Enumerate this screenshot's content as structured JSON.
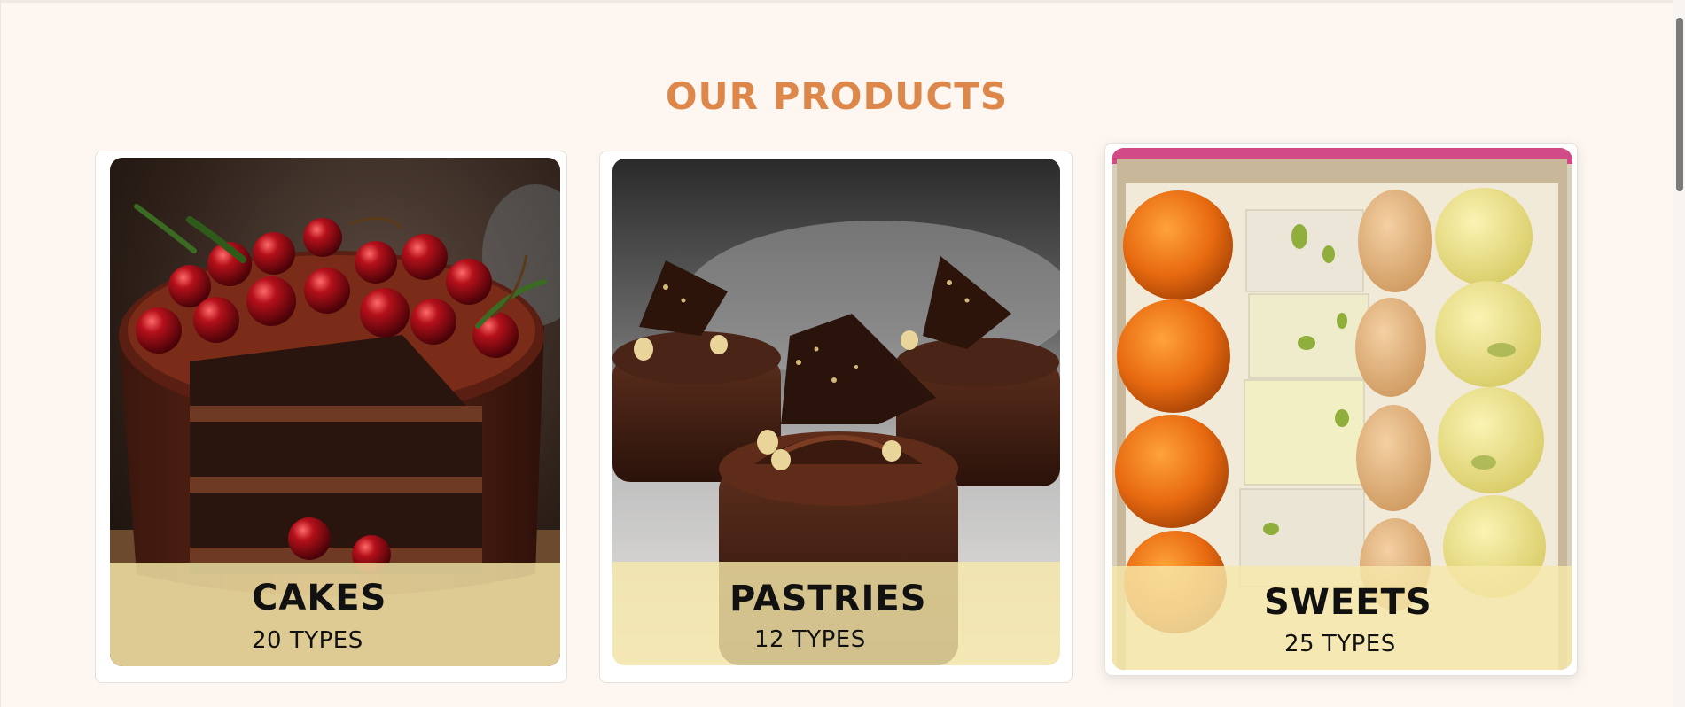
{
  "section": {
    "title": "OUR PRODUCTS",
    "title_color": "#dd884a"
  },
  "products": [
    {
      "title": "CAKES",
      "subtitle": "20 TYPES",
      "image": "chocolate-cherry-cake-image"
    },
    {
      "title": "PASTRIES",
      "subtitle": "12 TYPES",
      "image": "chocolate-pastries-image"
    },
    {
      "title": "SWEETS",
      "subtitle": "25 TYPES",
      "image": "indian-sweets-box-image"
    }
  ],
  "colors": {
    "background": "#fdf6f1",
    "label_band": "#f6e8aa",
    "text": "#111111"
  }
}
